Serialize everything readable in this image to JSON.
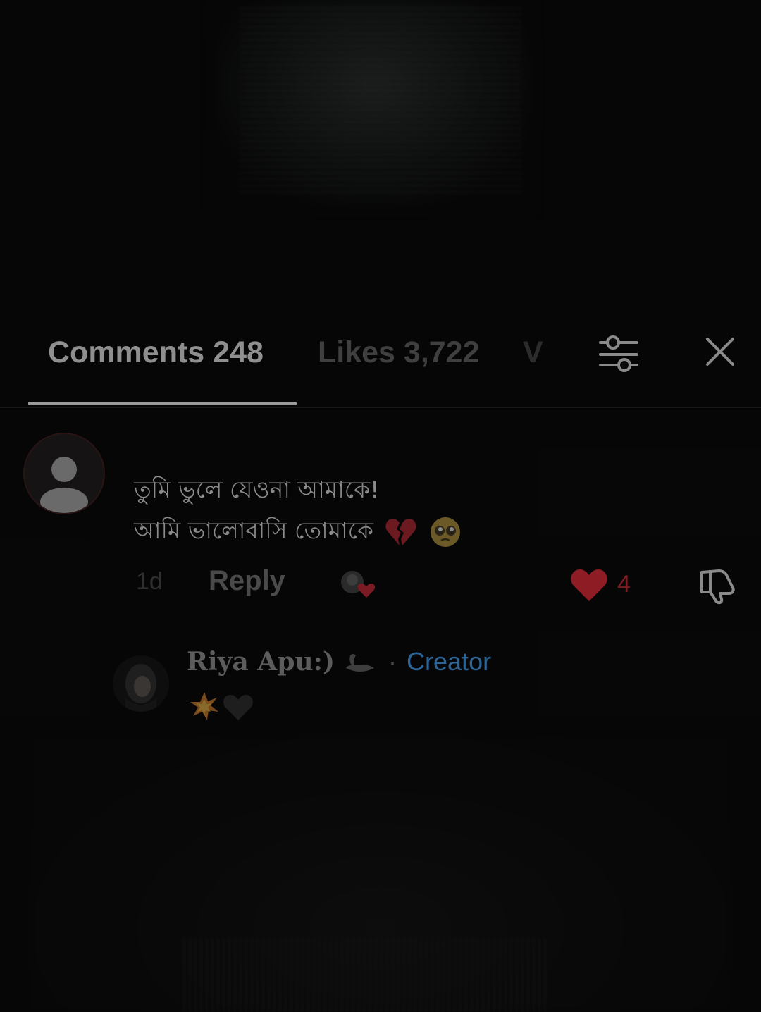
{
  "tabs": {
    "comments_label": "Comments 248",
    "likes_label": "Likes 3,722",
    "cut_label": "V"
  },
  "icons": {
    "filter": "filter-sliders-icon",
    "close": "close-icon"
  },
  "comment": {
    "text_line1": "তুমি ভুলে যেওনা আমাকে!",
    "text_line2": "আমি ভালোবাসি তোমাকে",
    "emojis": [
      "broken-heart",
      "pleading-face"
    ],
    "time": "1d",
    "reply_label": "Reply",
    "like_count": "4",
    "liked": true,
    "colors": {
      "heart": "#8e1c24",
      "text": "#8a8a8a"
    }
  },
  "reply": {
    "author": "Riya Apu:)",
    "separator": "·",
    "badge": "Creator",
    "badge_color": "#2c6496",
    "emojis": [
      "collision",
      "black-heart"
    ]
  }
}
